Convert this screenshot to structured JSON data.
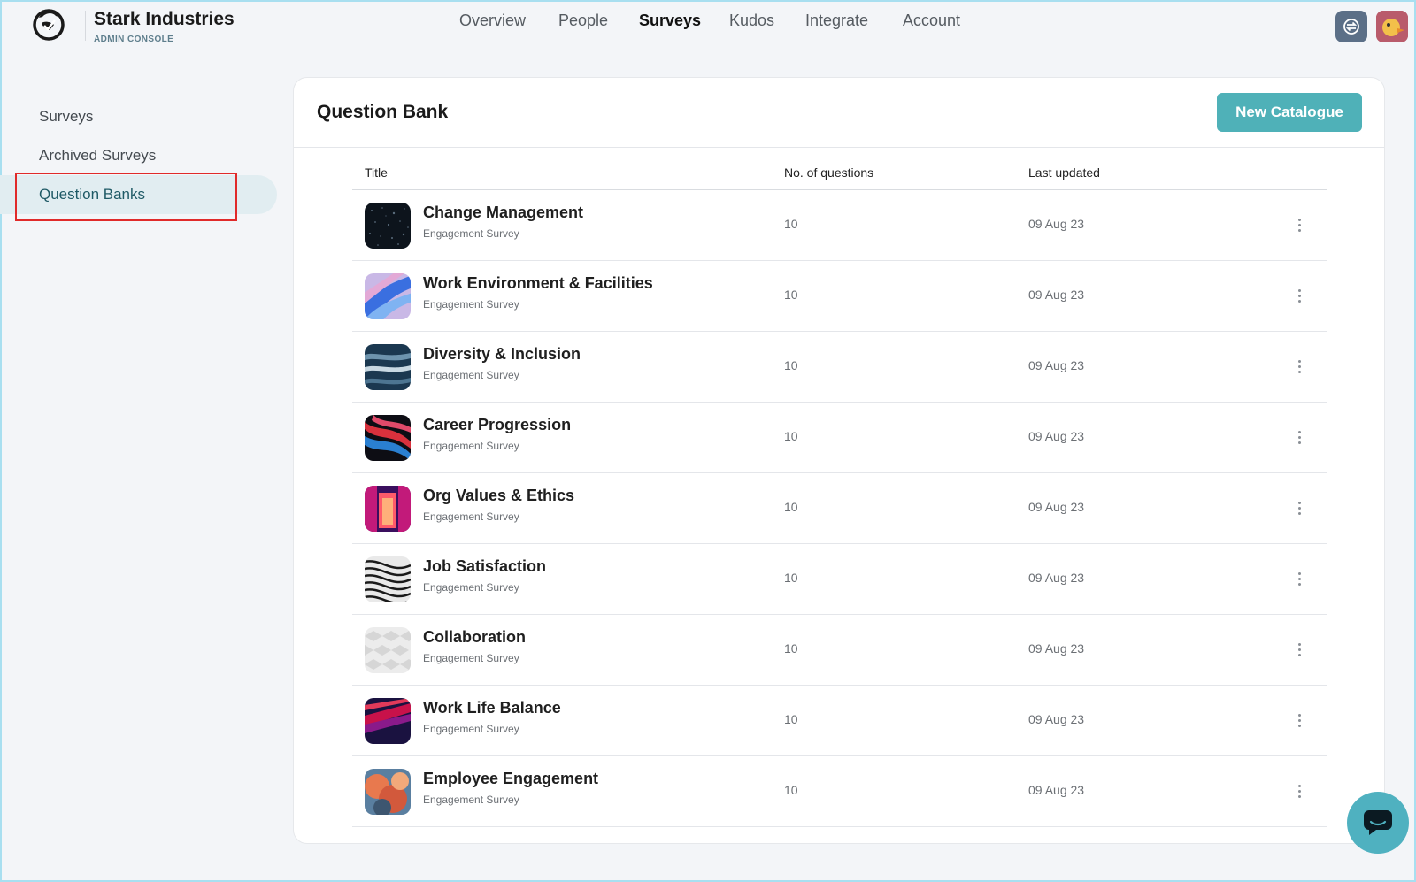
{
  "brand": {
    "name": "Stark Industries",
    "subtitle": "ADMIN CONSOLE",
    "logo_icon": "bird-logo-icon"
  },
  "nav": {
    "items": [
      {
        "label": "Overview",
        "active": false
      },
      {
        "label": "People",
        "active": false
      },
      {
        "label": "Surveys",
        "active": true
      },
      {
        "label": "Kudos",
        "active": false
      },
      {
        "label": "Integrate",
        "active": false
      },
      {
        "label": "Account",
        "active": false
      }
    ],
    "switch_icon": "switch-icon",
    "avatar_icon": "avatar-icon"
  },
  "sidebar": {
    "items": [
      {
        "label": "Surveys",
        "active": false
      },
      {
        "label": "Archived Surveys",
        "active": false
      },
      {
        "label": "Question Banks",
        "active": true
      }
    ]
  },
  "panel": {
    "title": "Question Bank",
    "new_button": "New Catalogue",
    "columns": {
      "title": "Title",
      "questions": "No. of questions",
      "updated": "Last updated"
    },
    "rows": [
      {
        "title": "Change Management",
        "subtitle": "Engagement Survey",
        "questions": "10",
        "updated": "09 Aug 23",
        "thumb": "dark-speckle"
      },
      {
        "title": "Work Environment & Facilities",
        "subtitle": "Engagement Survey",
        "questions": "10",
        "updated": "09 Aug 23",
        "thumb": "blue-pink-swirl"
      },
      {
        "title": "Diversity & Inclusion",
        "subtitle": "Engagement Survey",
        "questions": "10",
        "updated": "09 Aug 23",
        "thumb": "ocean-waves"
      },
      {
        "title": "Career Progression",
        "subtitle": "Engagement Survey",
        "questions": "10",
        "updated": "09 Aug 23",
        "thumb": "red-blue-waves"
      },
      {
        "title": "Org Values & Ethics",
        "subtitle": "Engagement Survey",
        "questions": "10",
        "updated": "09 Aug 23",
        "thumb": "neon-corridor"
      },
      {
        "title": "Job Satisfaction",
        "subtitle": "Engagement Survey",
        "questions": "10",
        "updated": "09 Aug 23",
        "thumb": "zebra-stripes"
      },
      {
        "title": "Collaboration",
        "subtitle": "Engagement Survey",
        "questions": "10",
        "updated": "09 Aug 23",
        "thumb": "white-pattern"
      },
      {
        "title": "Work Life Balance",
        "subtitle": "Engagement Survey",
        "questions": "10",
        "updated": "09 Aug 23",
        "thumb": "red-purple-streaks"
      },
      {
        "title": "Employee Engagement",
        "subtitle": "Engagement Survey",
        "questions": "10",
        "updated": "09 Aug 23",
        "thumb": "orange-clouds"
      }
    ],
    "row_menu_icon": "more-vertical-icon"
  },
  "chat": {
    "icon": "chat-bubble-icon"
  },
  "colors": {
    "accent": "#4fb1b8",
    "sidebar_active_bg": "#e1edf1",
    "highlight": "#e02a2a",
    "page_bg": "#f3f5f8"
  }
}
